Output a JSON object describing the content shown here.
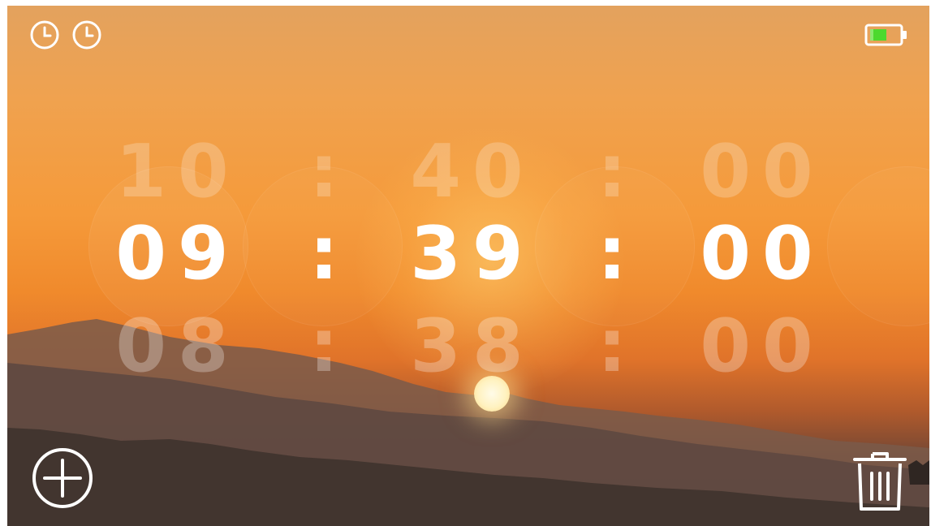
{
  "status_bar": {
    "left_icons": [
      "clock-icon",
      "clock-icon"
    ],
    "battery_icon": "battery-icon",
    "battery_color": "#4cd92e"
  },
  "time_picker": {
    "previous": {
      "hours": "10",
      "minutes": "40",
      "seconds": "00"
    },
    "current": {
      "hours": "09",
      "minutes": "39",
      "seconds": "00"
    },
    "next": {
      "hours": "08",
      "minutes": "38",
      "seconds": "00"
    },
    "separator": ":"
  },
  "actions": {
    "add_icon": "plus-circle-icon",
    "delete_icon": "trash-icon"
  }
}
